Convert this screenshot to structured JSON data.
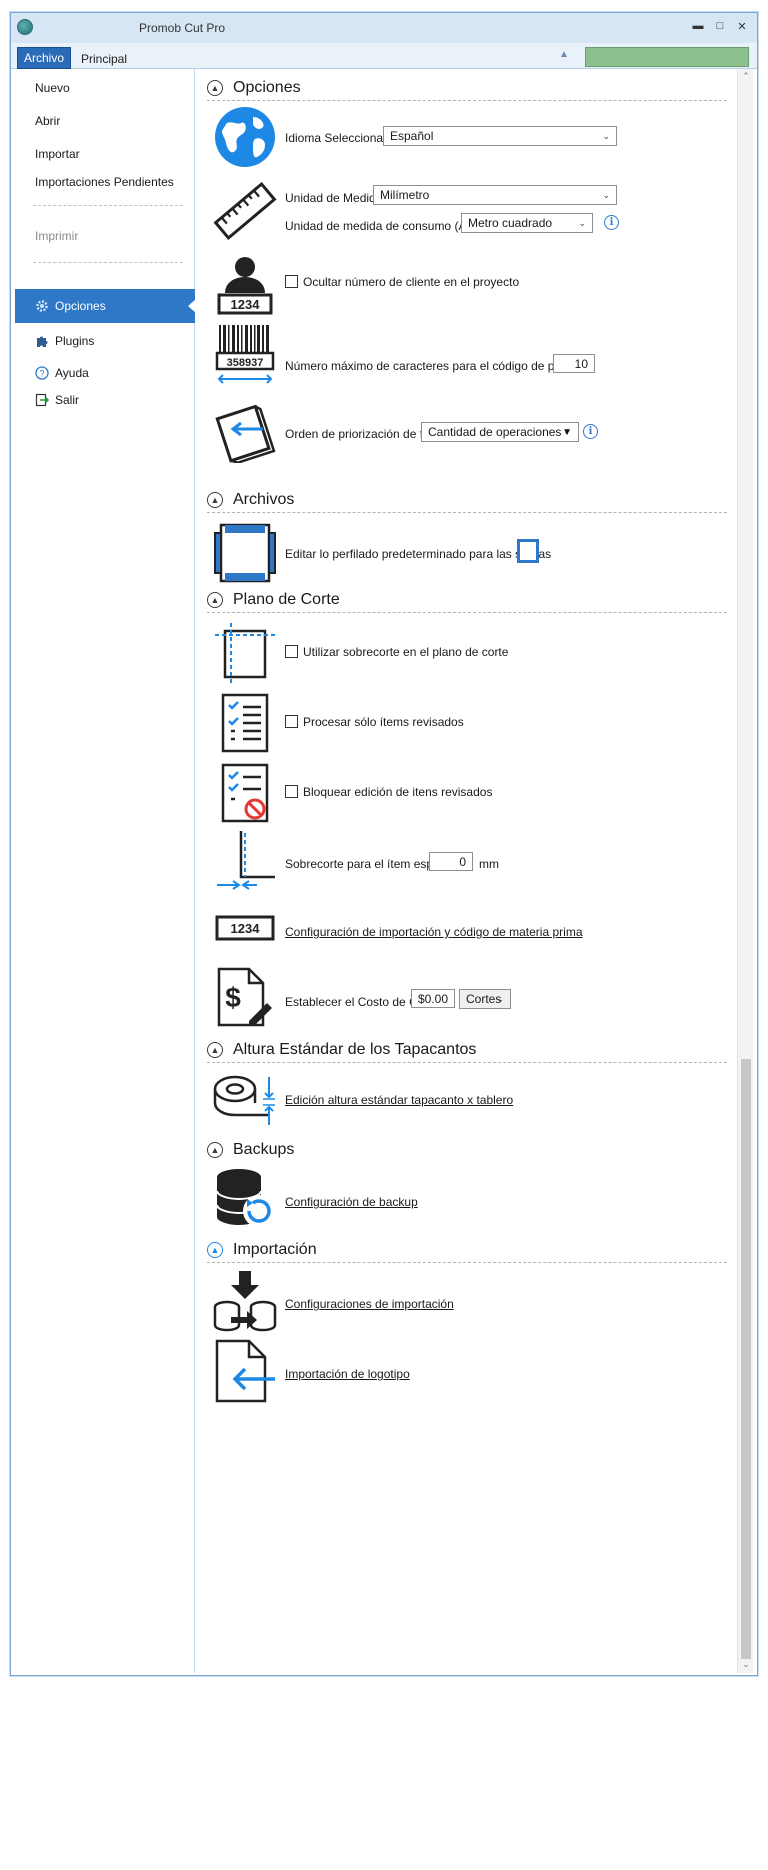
{
  "window": {
    "title": "Promob Cut Pro"
  },
  "ribbon": {
    "tab_file": "Archivo",
    "tab_main": "Principal"
  },
  "sidebar": {
    "items": [
      {
        "label": "Nuevo"
      },
      {
        "label": "Abrir"
      },
      {
        "label": "Importar"
      },
      {
        "label": "Importaciones Pendientes"
      },
      {
        "label": "Imprimir"
      },
      {
        "label": "Opciones"
      },
      {
        "label": "Plugins"
      },
      {
        "label": "Ayuda"
      },
      {
        "label": "Salir"
      }
    ]
  },
  "sections": {
    "opciones": "Opciones",
    "archivos": "Archivos",
    "plano": "Plano de Corte",
    "altura": "Altura Estándar de los Tapacantos",
    "backups": "Backups",
    "importacion": "Importación"
  },
  "options": {
    "language_label": "Idioma Seleccionado:",
    "language_value": "Español",
    "unit_label": "Unidad de Medida:",
    "unit_value": "Milímetro",
    "consumption_label": "Unidad de medida de consumo (Área):",
    "consumption_value": "Metro cuadrado",
    "hide_client_label": "Ocultar número de cliente en el proyecto",
    "client_badge": "1234",
    "barcode_number": "358937",
    "max_chars_label": "Número máximo de caracteres para el código de pieza.",
    "max_chars_value": "10",
    "face_priority_label": "Orden de priorización de face:",
    "face_priority_value": "Cantidad de operaciones - Cant"
  },
  "archivos": {
    "profile_label": "Editar lo perfilado predeterminado para las sobras"
  },
  "plano": {
    "overcut_label": "Utilizar sobrecorte en el plano de corte",
    "process_label": "Procesar sólo ítems revisados",
    "lock_label": "Bloquear edición de itens revisados",
    "special_label": "Sobrecorte para el ítem especial",
    "special_value": "0",
    "special_unit": "mm",
    "import_badge": "1234",
    "import_link": "Configuración de importación y código de materia prima",
    "cost_label": "Establecer el Costo de Corte",
    "cost_value": "$0.00",
    "cost_unit": "Cortes"
  },
  "altura": {
    "link": "Edición altura estándar tapacanto x tablero"
  },
  "backups": {
    "link": "Configuración de backup"
  },
  "importacion": {
    "config_link": "Configuraciones de importación",
    "logo_link": "Importación de logotipo"
  }
}
